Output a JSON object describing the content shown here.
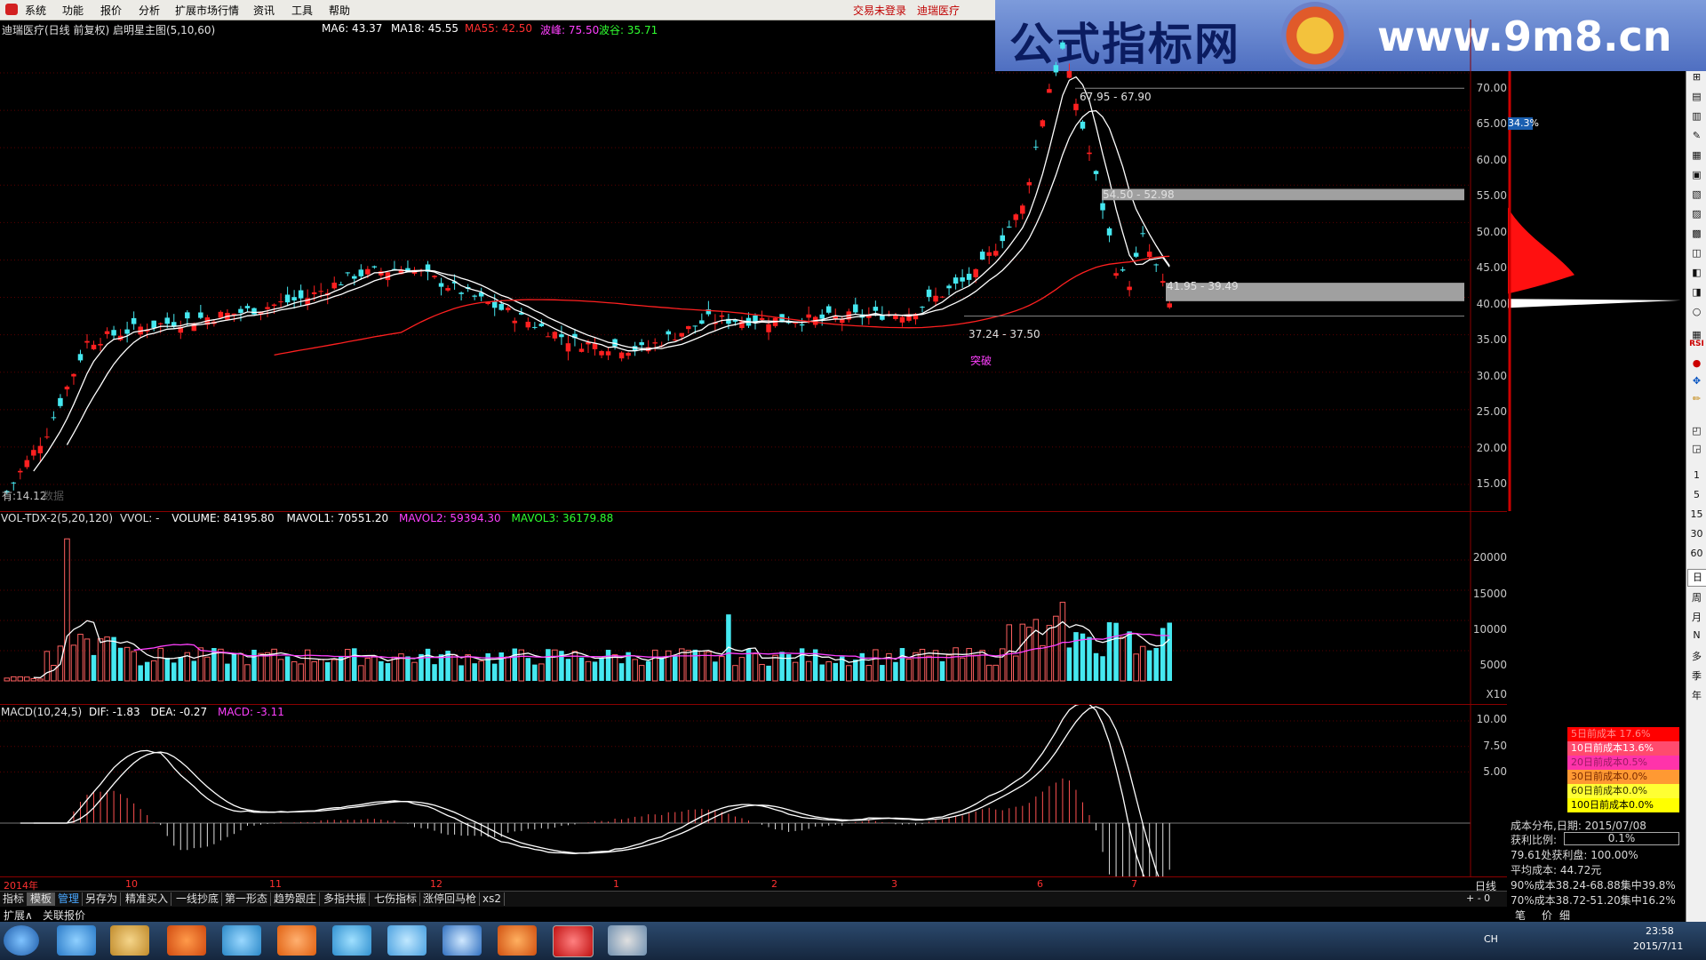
{
  "menubar": {
    "items": [
      "系统",
      "功能",
      "报价",
      "分析",
      "扩展市场行情",
      "资讯",
      "工具",
      "帮助"
    ],
    "status_login": "交易未登录",
    "status_stock": "迪瑞医疗"
  },
  "banner": {
    "title": "公式指标网",
    "url": "www.9m8.cn"
  },
  "main_title": {
    "stock": "迪瑞医疗(日线 前复权) 启明星主图(5,10,60)",
    "ma6": "MA6: 43.37",
    "ma18": "MA18: 45.55",
    "ma55": "MA55: 42.50",
    "bofeng": "波峰: 75.50",
    "bogu": "波谷: 35.71"
  },
  "main_axis": [
    "70.00",
    "65.00",
    "60.00",
    "55.00",
    "50.00",
    "45.00",
    "40.00",
    "35.00",
    "30.00",
    "25.00",
    "20.00",
    "15.00"
  ],
  "annotations": {
    "band1": "67.95 - 67.90",
    "band2": "54.50 - 52.98",
    "band3": "41.95 - 39.49",
    "band4": "37.24 - 37.50",
    "breakout": "突破",
    "low_label": "有:14.12",
    "data_label": "数据",
    "pct_badge": "34.3%"
  },
  "vol_title": {
    "name": "VOL-TDX-2(5,20,120)",
    "vvol": "VVOL: -",
    "volume": "VOLUME: 84195.80",
    "mavol1": "MAVOL1: 70551.20",
    "mavol2": "MAVOL2: 59394.30",
    "mavol3": "MAVOL3: 36179.88"
  },
  "vol_axis": [
    "20000",
    "15000",
    "10000",
    "5000"
  ],
  "vol_unit": "X10",
  "macd_title": {
    "name": "MACD(10,24,5)",
    "dif": "DIF: -1.83",
    "dea": "DEA: -0.27",
    "macd": "MACD: -3.11"
  },
  "macd_axis": [
    "10.00",
    "7.50",
    "5.00"
  ],
  "date_axis": [
    "2014年",
    "10",
    "11",
    "12",
    "1",
    "2",
    "3",
    "6",
    "7"
  ],
  "period_label": "日线",
  "tabs": [
    "指标",
    "模板",
    "管理",
    "另存为",
    "精准买入",
    "一线抄底",
    "第一形态",
    "趋势跟庄",
    "多指共振",
    "七伤指标",
    "涨停回马枪",
    "xs2"
  ],
  "bottom_links": [
    "扩展∧",
    "关联报价"
  ],
  "bottom_right_tabs": [
    "笔",
    "价",
    "细"
  ],
  "cost_legend": [
    {
      "label": "5日前成本 17.6%",
      "bg": "#ff0000",
      "fg": "#ff8c8c"
    },
    {
      "label": "10日前成本13.6%",
      "bg": "#ff4b6e",
      "fg": "#ffffff"
    },
    {
      "label": "20日前成本0.5%",
      "bg": "#ff33aa",
      "fg": "#9a1a64"
    },
    {
      "label": "30日前成本0.0%",
      "bg": "#ff9933",
      "fg": "#7a2a00"
    },
    {
      "label": "60日前成本0.0%",
      "bg": "#ffff33",
      "fg": "#333300"
    },
    {
      "label": "100日前成本0.0%",
      "bg": "#ffff00",
      "fg": "#000000"
    }
  ],
  "cost_info": {
    "date_line": "成本分布,日期: 2015/07/08",
    "profit_label": "获利比例:",
    "profit_value": "0.1%",
    "profit_price": "79.61处获利盘: 100.00%",
    "avg_cost": "平均成本: 44.72元",
    "c90": "90%成本38.24-68.88集中39.8%",
    "c70": "70%成本38.72-51.20集中16.2%"
  },
  "side_tools": [
    "RSI",
    "1",
    "5",
    "15",
    "30",
    "60",
    "日",
    "周",
    "月",
    "N",
    "多",
    "季",
    "年"
  ],
  "clock": {
    "time": "23:58",
    "date": "2015/7/11",
    "lang": "CH"
  },
  "colors": {
    "up": "#ff2020",
    "down": "#45e8f0",
    "ma_red": "#ff2020",
    "gridred": "#8b0000"
  }
}
